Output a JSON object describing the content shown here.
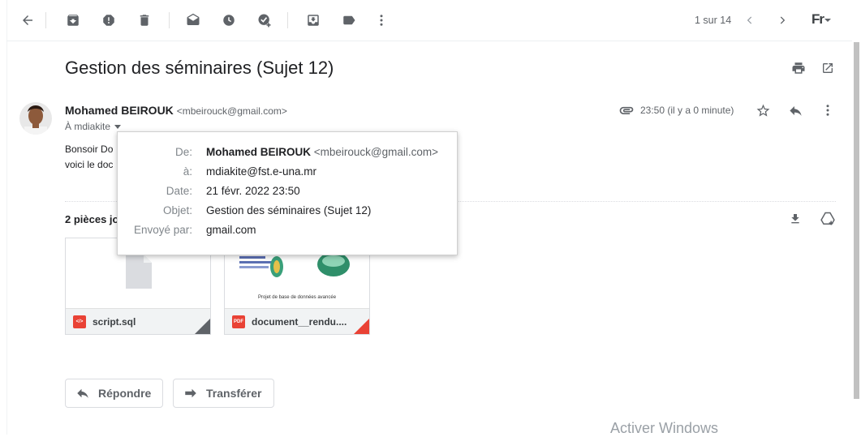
{
  "toolbar": {
    "icons": [
      "back-arrow-icon",
      "archive-icon",
      "report-spam-icon",
      "delete-icon",
      "mark-unread-icon",
      "snooze-icon",
      "add-task-icon",
      "move-to-icon",
      "label-icon",
      "more-vert-icon"
    ],
    "pager": "1 sur 14",
    "lang": "Fr"
  },
  "email": {
    "subject": "Gestion des séminaires (Sujet 12)",
    "sender_name": "Mohamed BEIROUK",
    "sender_email": "<mbeirouck@gmail.com>",
    "to": "À mdiakite",
    "time": "23:50 (il y a 0 minute)",
    "body_line1": "Bonsoir Do",
    "body_line2": "voici le doc"
  },
  "details_popup": {
    "rows": [
      {
        "key": "De:",
        "value": "Mohamed BEIROUK",
        "extra": " <mbeirouck@gmail.com>"
      },
      {
        "key": "à:",
        "value": "mdiakite@fst.e-una.mr"
      },
      {
        "key": "Date:",
        "value": "21 févr. 2022 23:50"
      },
      {
        "key": "Objet:",
        "value": "Gestion des séminaires (Sujet 12)"
      },
      {
        "key": "Envoyé par:",
        "value": "gmail.com"
      }
    ]
  },
  "attachments": {
    "title": "2 pièces jo",
    "files": [
      {
        "name": "script.sql",
        "type_label": "</>",
        "type_color": "#e94235"
      },
      {
        "name": "document__rendu....",
        "type_label": "PDF",
        "type_color": "#e94235",
        "preview_caption": "Projet de base de données avancée"
      }
    ]
  },
  "actions": {
    "reply": "Répondre",
    "forward": "Transférer"
  },
  "watermark": "Activer Windows"
}
